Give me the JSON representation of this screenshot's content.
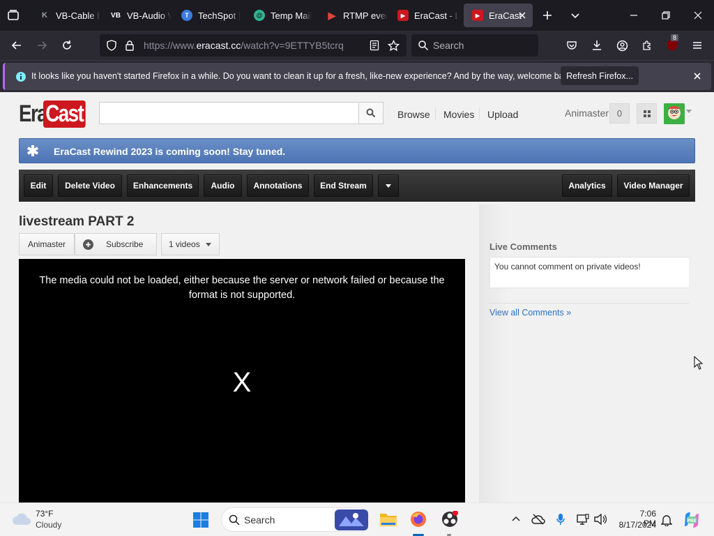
{
  "browser": {
    "tabs": [
      {
        "label": "VB-Cable b",
        "icon": "K"
      },
      {
        "label": "VB-Audio V",
        "icon": "VB"
      },
      {
        "label": "TechSpot |",
        "icon": "T"
      },
      {
        "label": "Temp Mail",
        "icon": "@"
      },
      {
        "label": "RTMP ever",
        "icon": "▶"
      },
      {
        "label": "EraCast - L",
        "icon": "▶"
      },
      {
        "label": "EraCast",
        "icon": "▶",
        "active": true
      }
    ],
    "url_prefix": "https://www.",
    "url_domain": "eracast.cc",
    "url_path": "/watch?v=9ETTYB5tcrq",
    "search_placeholder": "Search",
    "extension_badge": "8"
  },
  "notification": {
    "text": "It looks like you haven't started Firefox in a while. Do you want to clean it up for a fresh, like-new experience? And by the way, welcome back!",
    "button_label": "Refresh Firefox..."
  },
  "site": {
    "logo_left": "Era",
    "logo_right": "Cast",
    "search_value": "",
    "nav": {
      "browse": "Browse",
      "movies": "Movies",
      "upload": "Upload"
    },
    "user": {
      "name": "Animaster",
      "notification_count": "0"
    },
    "banner": "EraCast Rewind 2023 is coming soon! Stay tuned.",
    "toolbar": {
      "edit": "Edit",
      "delete": "Delete Video",
      "enhancements": "Enhancements",
      "audio": "Audio",
      "annotations": "Annotations",
      "end_stream": "End Stream",
      "analytics": "Analytics",
      "video_manager": "Video Manager"
    },
    "video": {
      "title": "livestream PART 2",
      "channel": "Animaster",
      "subscribe": "Subscribe",
      "videos_count": "1 videos",
      "error_message": "The media could not be loaded, either because the server or network failed or because the format is not supported.",
      "error_symbol": "X"
    },
    "comments": {
      "title": "Live Comments",
      "message": "You cannot comment on private videos!",
      "view_all": "View all Comments »"
    }
  },
  "taskbar": {
    "weather_temp": "73°F",
    "weather_condition": "Cloudy",
    "search_label": "Search",
    "time": "7:06 PM",
    "date": "8/17/2024"
  },
  "colors": {
    "accent_red": "#cc181e",
    "banner_blue": "#4d74b3",
    "link_blue": "#2f6fbf",
    "firefox_purple": "#b865ff"
  }
}
